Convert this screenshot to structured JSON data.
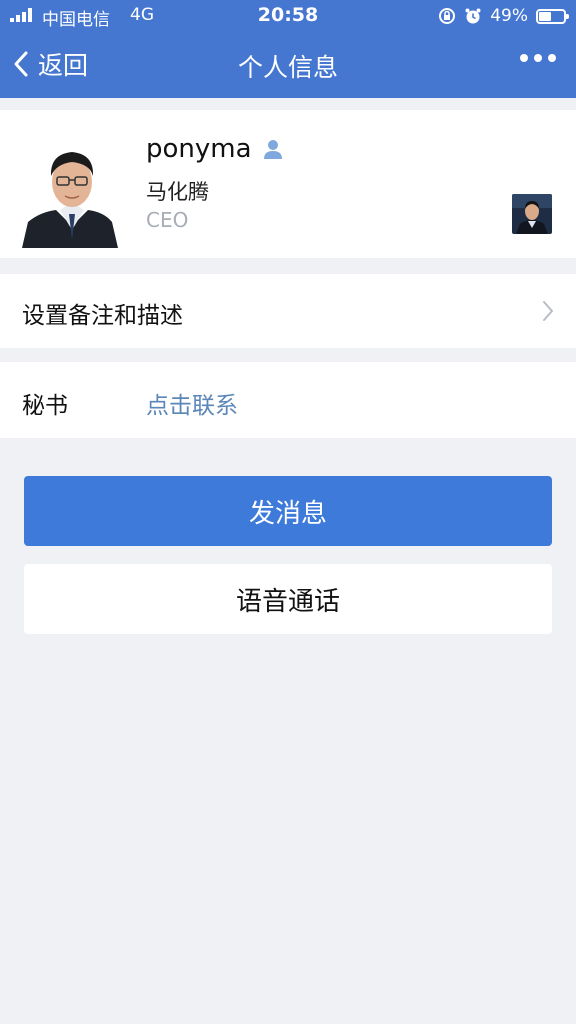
{
  "status_bar": {
    "carrier": "中国电信",
    "network": "4G",
    "time": "20:58",
    "battery_percent": "49%",
    "battery_level": 0.49
  },
  "nav": {
    "back_label": "返回",
    "title": "个人信息"
  },
  "profile": {
    "username": "ponyma",
    "real_name": "马化腾",
    "job_title": "CEO"
  },
  "rows": {
    "remark_label": "设置备注和描述",
    "secretary_label": "秘书",
    "secretary_action": "点击联系"
  },
  "actions": {
    "send_message": "发消息",
    "voice_call": "语音通话"
  },
  "colors": {
    "header": "#4577d1",
    "primary_button": "#3e7ad9",
    "link": "#5a86b8",
    "background": "#f0f1f5"
  }
}
